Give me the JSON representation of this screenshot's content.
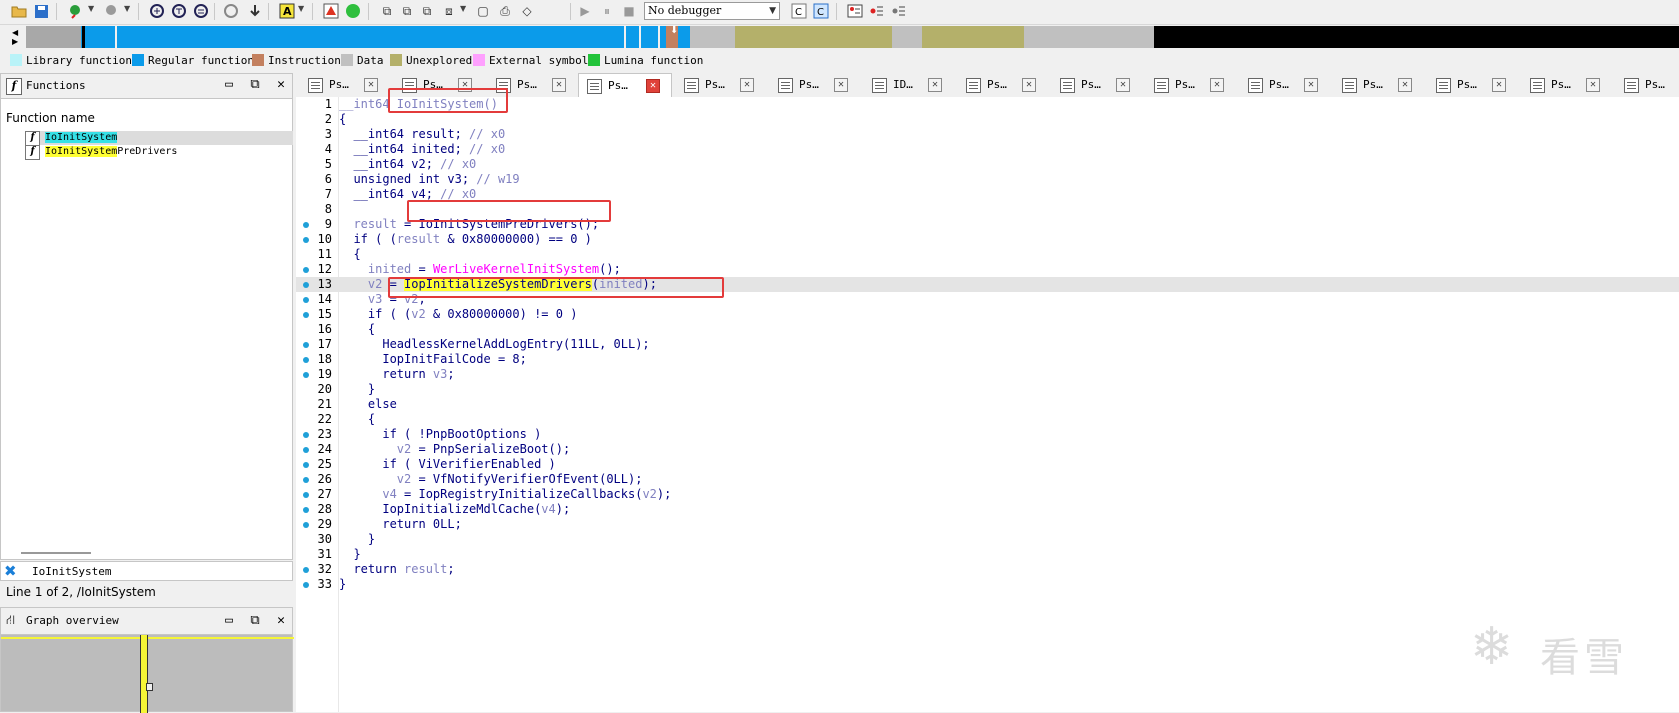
{
  "toolbar": {
    "debugger_select": "No debugger",
    "icons": [
      "open-icon",
      "save-icon",
      "jump-back-icon",
      "jump-forward-icon",
      "graph-icon",
      "text-view-icon",
      "hex-view-icon",
      "refresh-icon",
      "go-to-icon",
      "string-icon",
      "breakpoint-icon",
      "run-icon",
      "start-icon",
      "pause-icon",
      "stop-icon",
      "ida-c-icon",
      "decompile-icon",
      "breakpoint-list-icon",
      "step-into-icon",
      "step-over-icon"
    ]
  },
  "navband": {
    "segments": [
      {
        "color": "#a8a8a8"
      },
      {
        "color": "#0b9bea"
      },
      {
        "color": "#b4b06a"
      },
      {
        "color": "#c0c0c0"
      },
      {
        "color": "#000000"
      }
    ]
  },
  "legend": [
    {
      "label": "Library function",
      "color": "#b9f3f8"
    },
    {
      "label": "Regular function",
      "color": "#0b9bea"
    },
    {
      "label": "Instruction",
      "color": "#c3805f"
    },
    {
      "label": "Data",
      "color": "#c0c0c0"
    },
    {
      "label": "Unexplored",
      "color": "#b4b06a"
    },
    {
      "label": "External symbol",
      "color": "#fea0fe"
    },
    {
      "label": "Lumina function",
      "color": "#22c33a"
    }
  ],
  "functions_panel": {
    "title": "Functions",
    "column_header": "Function name",
    "rows": [
      {
        "match": "IoInitSystem",
        "rest": ""
      },
      {
        "match": "IoInitSystem",
        "rest": "PreDrivers"
      }
    ]
  },
  "search": {
    "text": "IoInitSystem"
  },
  "status": {
    "text": "Line 1 of 2, /IoInitSystem"
  },
  "graph_panel": {
    "title": "Graph overview"
  },
  "tabs": [
    {
      "label": "Ps…",
      "active": false
    },
    {
      "label": "Ps…",
      "active": false
    },
    {
      "label": "Ps…",
      "active": false
    },
    {
      "label": "Ps…",
      "active": true
    },
    {
      "label": "Ps…",
      "active": false
    },
    {
      "label": "Ps…",
      "active": false
    },
    {
      "label": "ID…",
      "active": false
    },
    {
      "label": "Ps…",
      "active": false
    },
    {
      "label": "Ps…",
      "active": false
    },
    {
      "label": "Ps…",
      "active": false
    },
    {
      "label": "Ps…",
      "active": false
    },
    {
      "label": "Ps…",
      "active": false
    },
    {
      "label": "Ps…",
      "active": false
    },
    {
      "label": "Ps…",
      "active": false
    },
    {
      "label": "Ps…",
      "active": false
    }
  ],
  "code": {
    "lines": [
      {
        "n": "1",
        "dot": false,
        "html": "<span class=\"c-cmt\">__int64 </span><span class=\"c-var\">IoInitSystem()</span>"
      },
      {
        "n": "2",
        "dot": false,
        "html": "{"
      },
      {
        "n": "3",
        "dot": false,
        "html": "  __int64 result; <span class=\"c-cmt\">// x0</span>"
      },
      {
        "n": "4",
        "dot": false,
        "html": "  __int64 inited; <span class=\"c-cmt\">// x0</span>"
      },
      {
        "n": "5",
        "dot": false,
        "html": "  __int64 v2; <span class=\"c-cmt\">// x0</span>"
      },
      {
        "n": "6",
        "dot": false,
        "html": "  unsigned int v3; <span class=\"c-cmt\">// w19</span>"
      },
      {
        "n": "7",
        "dot": false,
        "html": "  __int64 v4; <span class=\"c-cmt\">// x0</span>"
      },
      {
        "n": "8",
        "dot": false,
        "html": ""
      },
      {
        "n": "9",
        "dot": true,
        "html": "  <span class=\"c-var\">result</span> = IoInitSystemPreDrivers();"
      },
      {
        "n": "10",
        "dot": true,
        "html": "  if ( (<span class=\"c-var\">result</span> &amp; 0x80000000) == 0 )"
      },
      {
        "n": "11",
        "dot": false,
        "html": "  {"
      },
      {
        "n": "12",
        "dot": true,
        "html": "    <span class=\"c-var\">inited</span> = <span class=\"c-ext\">WerLiveKernelInitSystem</span>();"
      },
      {
        "n": "13",
        "dot": true,
        "html": "    <span class=\"c-var\">v2</span> = <span class=\"c-hl\">IopInitializeSystemDrivers</span>(<span class=\"c-var\">inited</span>);",
        "cur": true
      },
      {
        "n": "14",
        "dot": true,
        "html": "    <span class=\"c-var\">v3</span> = <span class=\"c-var\">v2</span>;"
      },
      {
        "n": "15",
        "dot": true,
        "html": "    if ( (<span class=\"c-var\">v2</span> &amp; 0x80000000) != 0 )"
      },
      {
        "n": "16",
        "dot": false,
        "html": "    {"
      },
      {
        "n": "17",
        "dot": true,
        "html": "      HeadlessKernelAddLogEntry(11LL, 0LL);"
      },
      {
        "n": "18",
        "dot": true,
        "html": "      IopInitFailCode = 8;"
      },
      {
        "n": "19",
        "dot": true,
        "html": "      return <span class=\"c-var\">v3</span>;"
      },
      {
        "n": "20",
        "dot": false,
        "html": "    }"
      },
      {
        "n": "21",
        "dot": false,
        "html": "    else"
      },
      {
        "n": "22",
        "dot": false,
        "html": "    {"
      },
      {
        "n": "23",
        "dot": true,
        "html": "      if ( !PnpBootOptions )"
      },
      {
        "n": "24",
        "dot": true,
        "html": "        <span class=\"c-var\">v2</span> = PnpSerializeBoot();"
      },
      {
        "n": "25",
        "dot": true,
        "html": "      if ( ViVerifierEnabled )"
      },
      {
        "n": "26",
        "dot": true,
        "html": "        <span class=\"c-var\">v2</span> = VfNotifyVerifierOfEvent(0LL);"
      },
      {
        "n": "27",
        "dot": true,
        "html": "      <span class=\"c-var\">v4</span> = IopRegistryInitializeCallbacks(<span class=\"c-var\">v2</span>);"
      },
      {
        "n": "28",
        "dot": true,
        "html": "      IopInitializeMdlCache(<span class=\"c-var\">v4</span>);"
      },
      {
        "n": "29",
        "dot": true,
        "html": "      return 0LL;"
      },
      {
        "n": "30",
        "dot": false,
        "html": "    }"
      },
      {
        "n": "31",
        "dot": false,
        "html": "  }"
      },
      {
        "n": "32",
        "dot": true,
        "html": "  return <span class=\"c-var\">result</span>;"
      },
      {
        "n": "33",
        "dot": true,
        "html": "}"
      }
    ]
  },
  "watermark": {
    "text": "看雪"
  }
}
